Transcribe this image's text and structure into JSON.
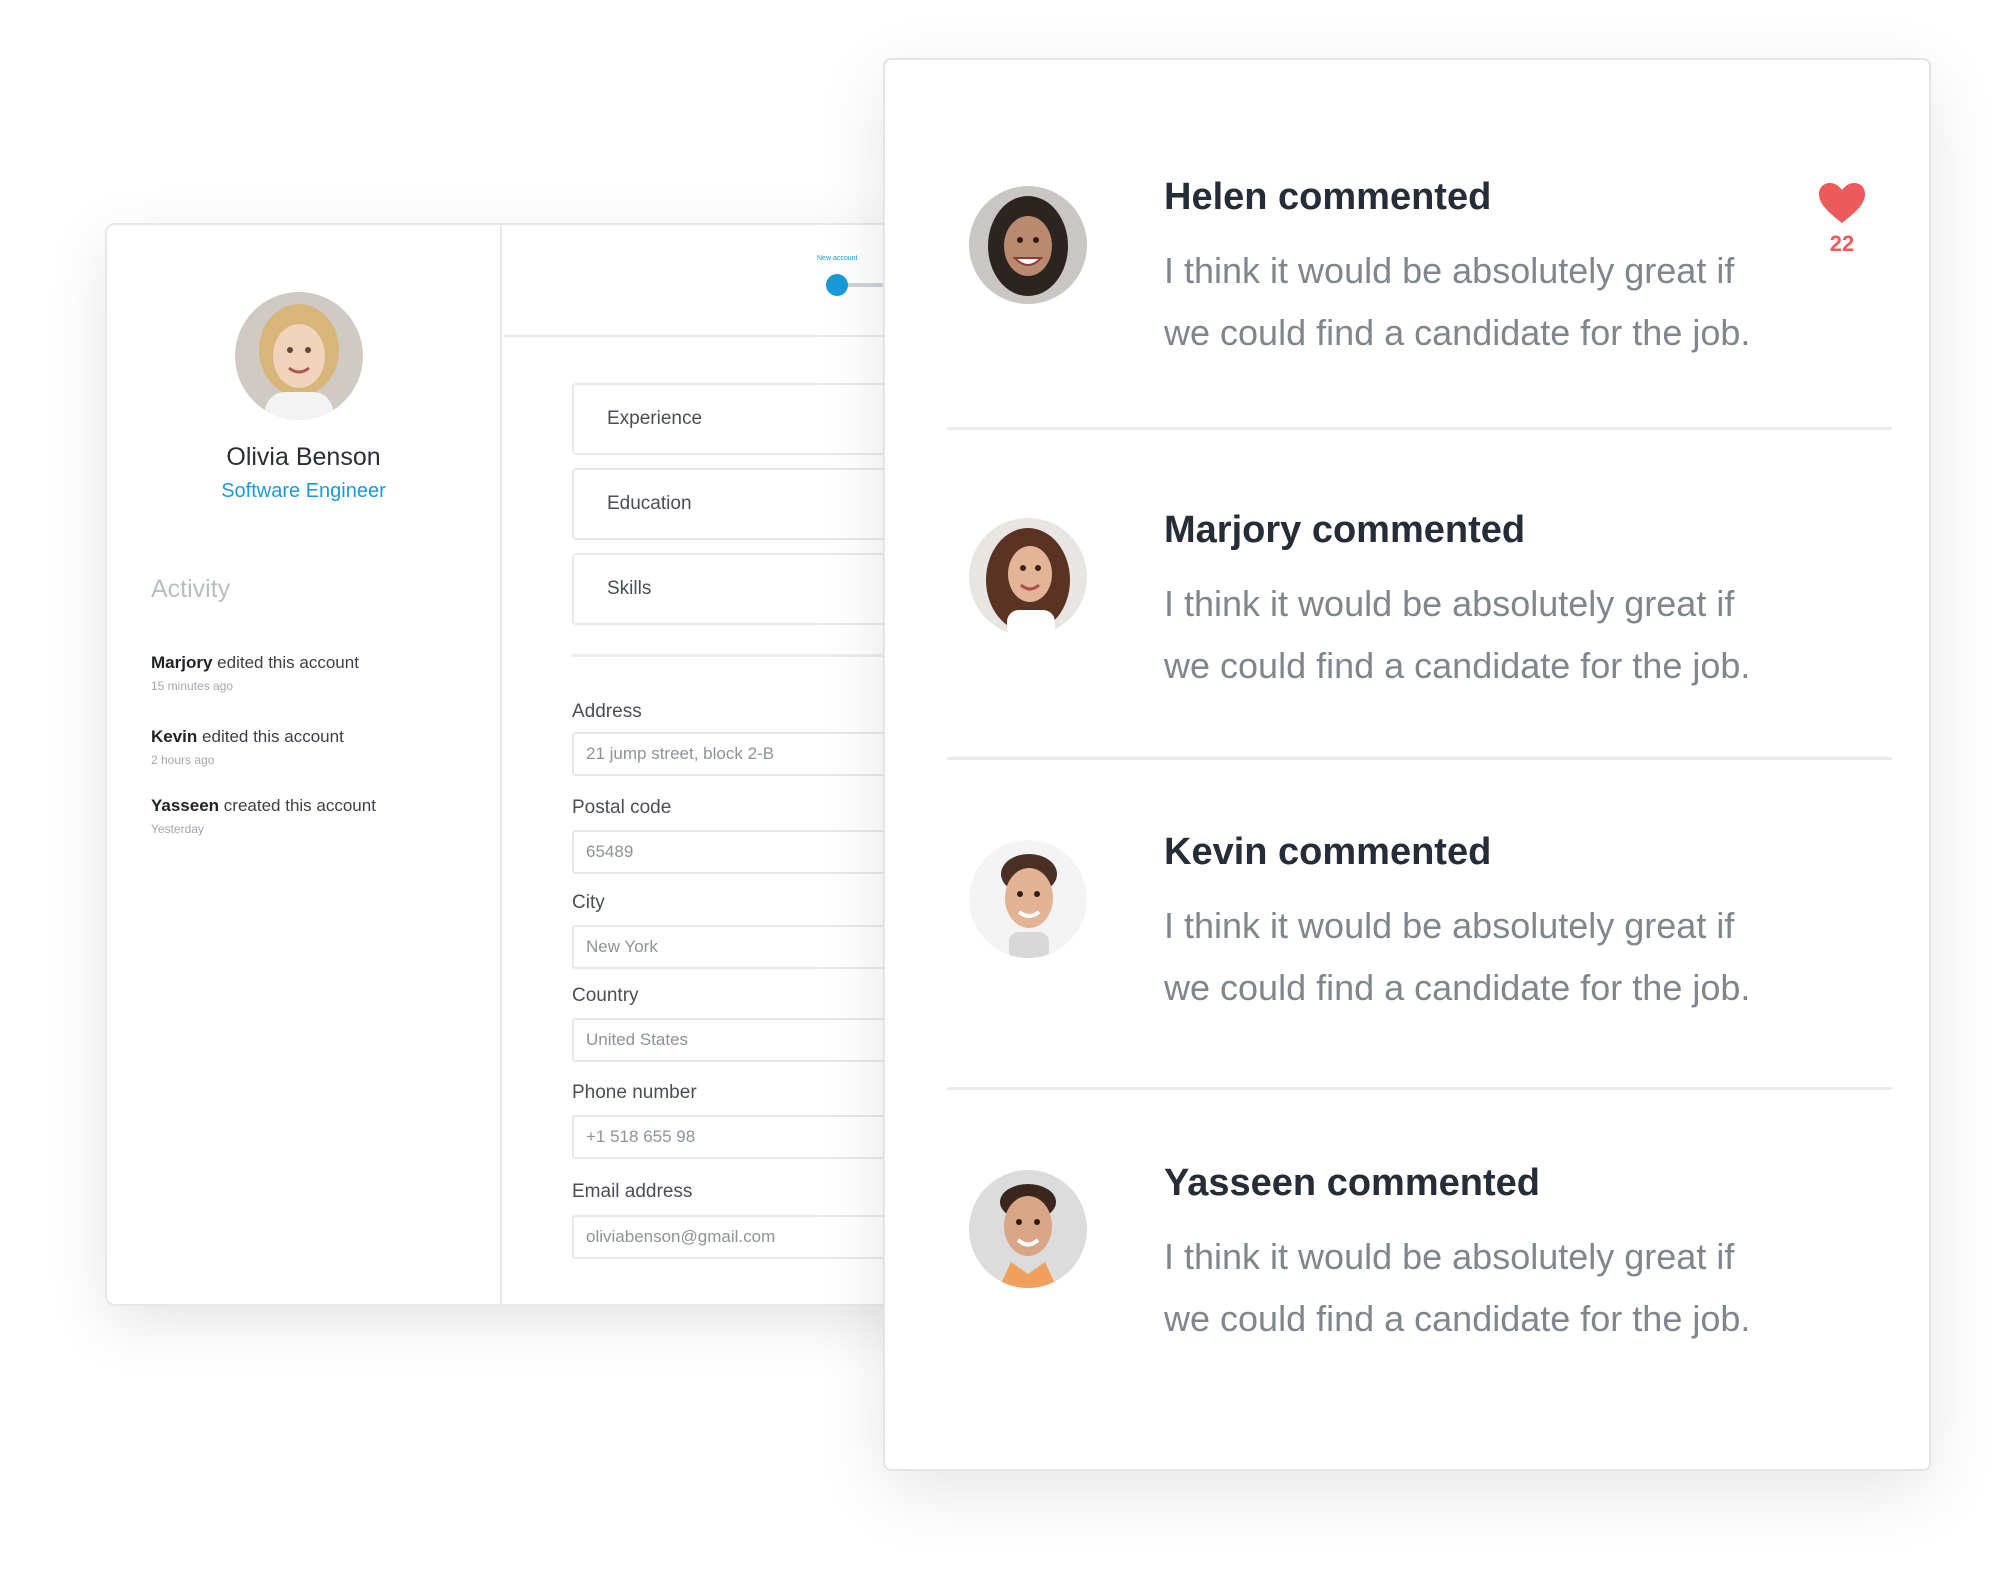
{
  "profile": {
    "name": "Olivia Benson",
    "role": "Software Engineer",
    "activity_heading": "Activity",
    "activity": [
      {
        "actor": "Marjory",
        "action": "edited this account",
        "time": "15 minutes ago"
      },
      {
        "actor": "Kevin",
        "action": "edited this account",
        "time": "2 hours ago"
      },
      {
        "actor": "Yasseen",
        "action": "created this account",
        "time": "Yesterday"
      }
    ]
  },
  "stepper": {
    "step_label": "New account"
  },
  "form": {
    "sections": [
      "Experience",
      "Education",
      "Skills"
    ],
    "fields": [
      {
        "label": "Address",
        "value": "21 jump street, block 2-B"
      },
      {
        "label": "Postal code",
        "value": "65489"
      },
      {
        "label": "City",
        "value": "New York"
      },
      {
        "label": "Country",
        "value": "United States"
      },
      {
        "label": "Phone number",
        "value": "+1 518 655 98"
      },
      {
        "label": "Email address",
        "value": "oliviabenson@gmail.com"
      }
    ]
  },
  "comments": [
    {
      "title": "Helen commented",
      "line1": "I think it would be absolutely great if",
      "line2": "we could find a candidate for the job."
    },
    {
      "title": "Marjory commented",
      "line1": "I think it would be absolutely great if",
      "line2": "we could find a candidate for the job."
    },
    {
      "title": "Kevin commented",
      "line1": "I think it would be absolutely great if",
      "line2": "we could find a candidate for the job."
    },
    {
      "title": "Yasseen commented",
      "line1": "I think it would be absolutely great if",
      "line2": "we could find a candidate for the job."
    }
  ],
  "like": {
    "count": "22",
    "icon": "heart-icon",
    "color": "#ec5a5a"
  },
  "colors": {
    "accent": "#1a9ad9",
    "title_text": "#252d38",
    "body_text": "#7f868e"
  }
}
